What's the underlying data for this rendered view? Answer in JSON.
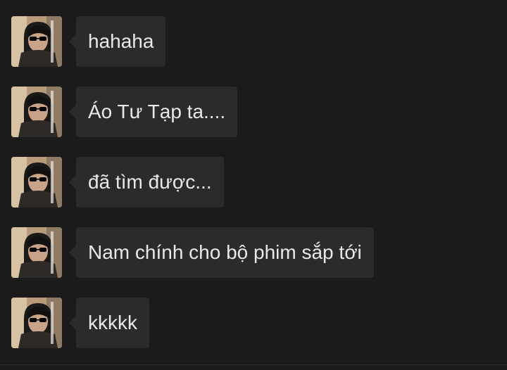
{
  "conversation": {
    "messages": [
      {
        "sender_avatar": "avatar-photo",
        "text": "hahaha"
      },
      {
        "sender_avatar": "avatar-photo",
        "text": "Áo Tư Tạp ta...."
      },
      {
        "sender_avatar": "avatar-photo",
        "text": "đã tìm được..."
      },
      {
        "sender_avatar": "avatar-photo",
        "text": "Nam chính cho bộ phim sắp tới"
      },
      {
        "sender_avatar": "avatar-photo",
        "text": "kkkkk"
      }
    ]
  },
  "colors": {
    "background": "#1b1b1b",
    "bubble": "#2b2b2b",
    "text": "#e8e8e8"
  }
}
